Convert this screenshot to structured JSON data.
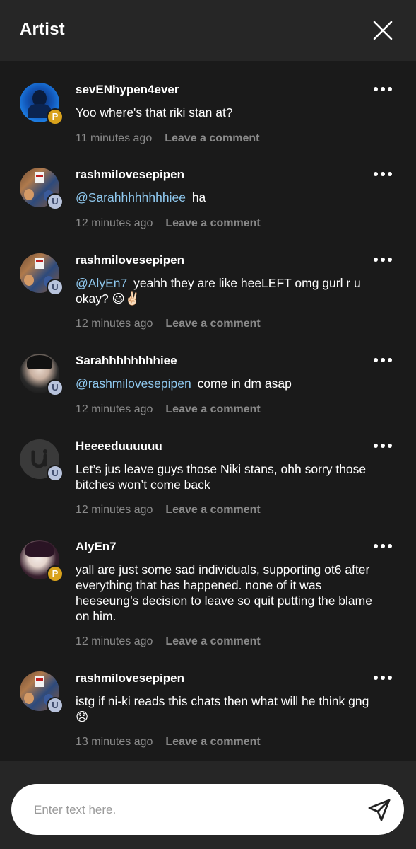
{
  "header": {
    "title": "Artist",
    "close_icon": "close-icon"
  },
  "comments": [
    {
      "username": "sevENhypen4ever",
      "badge": "P",
      "mention": "",
      "text": "Yoo where's that riki stan at?",
      "time": "11 minutes ago",
      "leave": "Leave a comment"
    },
    {
      "username": "rashmilovesepipen",
      "badge": "U",
      "mention": "@Sarahhhhhhhhiee",
      "text": "ha",
      "time": "12 minutes ago",
      "leave": "Leave a comment"
    },
    {
      "username": "rashmilovesepipen",
      "badge": "U",
      "mention": "@AlyEn7",
      "text": "yeahh they are like heeLEFT omg gurl r u okay? 😃✌🏻",
      "time": "12 minutes ago",
      "leave": "Leave a comment"
    },
    {
      "username": "Sarahhhhhhhhiee",
      "badge": "U",
      "mention": "@rashmilovesepipen",
      "text": "come in dm asap",
      "time": "12 minutes ago",
      "leave": "Leave a comment"
    },
    {
      "username": "Heeeeduuuuuu",
      "badge": "U",
      "mention": "",
      "text": "Let’s jus leave guys those Niki stans, ohh sorry those bitches won’t come back",
      "time": "12 minutes ago",
      "leave": "Leave a comment"
    },
    {
      "username": "AlyEn7",
      "badge": "P",
      "mention": "",
      "text": "yall are just some sad individuals, supporting ot6 after everything that has happened. none of it was heeseung’s decision to leave so quit putting the blame on him.",
      "time": "12 minutes ago",
      "leave": "Leave a comment"
    },
    {
      "username": "rashmilovesepipen",
      "badge": "U",
      "mention": "",
      "text": "istg if ni-ki reads this chats then what will he think gng 😞",
      "time": "13 minutes ago",
      "leave": "Leave a comment"
    }
  ],
  "composer": {
    "placeholder": "Enter text here.",
    "send_icon": "send-icon"
  },
  "colors": {
    "background": "#1a1a1a",
    "header": "#262626",
    "mention": "#8fc8ee",
    "meta": "#8a8a8a",
    "badge_p": "#d9a21c",
    "badge_u": "#b8c3dc"
  }
}
